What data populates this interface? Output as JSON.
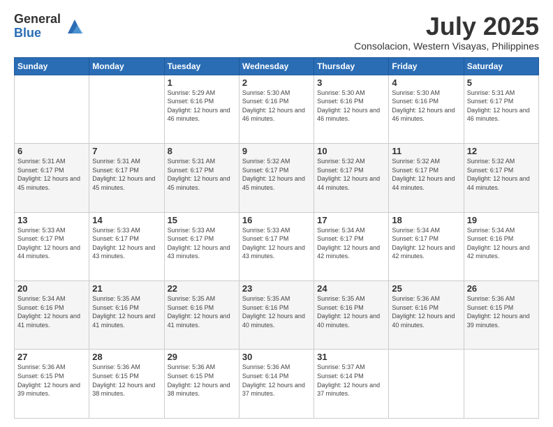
{
  "logo": {
    "general": "General",
    "blue": "Blue"
  },
  "header": {
    "month": "July 2025",
    "location": "Consolacion, Western Visayas, Philippines"
  },
  "weekdays": [
    "Sunday",
    "Monday",
    "Tuesday",
    "Wednesday",
    "Thursday",
    "Friday",
    "Saturday"
  ],
  "weeks": [
    [
      {
        "day": "",
        "info": ""
      },
      {
        "day": "",
        "info": ""
      },
      {
        "day": "1",
        "info": "Sunrise: 5:29 AM\nSunset: 6:16 PM\nDaylight: 12 hours and 46 minutes."
      },
      {
        "day": "2",
        "info": "Sunrise: 5:30 AM\nSunset: 6:16 PM\nDaylight: 12 hours and 46 minutes."
      },
      {
        "day": "3",
        "info": "Sunrise: 5:30 AM\nSunset: 6:16 PM\nDaylight: 12 hours and 46 minutes."
      },
      {
        "day": "4",
        "info": "Sunrise: 5:30 AM\nSunset: 6:16 PM\nDaylight: 12 hours and 46 minutes."
      },
      {
        "day": "5",
        "info": "Sunrise: 5:31 AM\nSunset: 6:17 PM\nDaylight: 12 hours and 46 minutes."
      }
    ],
    [
      {
        "day": "6",
        "info": "Sunrise: 5:31 AM\nSunset: 6:17 PM\nDaylight: 12 hours and 45 minutes."
      },
      {
        "day": "7",
        "info": "Sunrise: 5:31 AM\nSunset: 6:17 PM\nDaylight: 12 hours and 45 minutes."
      },
      {
        "day": "8",
        "info": "Sunrise: 5:31 AM\nSunset: 6:17 PM\nDaylight: 12 hours and 45 minutes."
      },
      {
        "day": "9",
        "info": "Sunrise: 5:32 AM\nSunset: 6:17 PM\nDaylight: 12 hours and 45 minutes."
      },
      {
        "day": "10",
        "info": "Sunrise: 5:32 AM\nSunset: 6:17 PM\nDaylight: 12 hours and 44 minutes."
      },
      {
        "day": "11",
        "info": "Sunrise: 5:32 AM\nSunset: 6:17 PM\nDaylight: 12 hours and 44 minutes."
      },
      {
        "day": "12",
        "info": "Sunrise: 5:32 AM\nSunset: 6:17 PM\nDaylight: 12 hours and 44 minutes."
      }
    ],
    [
      {
        "day": "13",
        "info": "Sunrise: 5:33 AM\nSunset: 6:17 PM\nDaylight: 12 hours and 44 minutes."
      },
      {
        "day": "14",
        "info": "Sunrise: 5:33 AM\nSunset: 6:17 PM\nDaylight: 12 hours and 43 minutes."
      },
      {
        "day": "15",
        "info": "Sunrise: 5:33 AM\nSunset: 6:17 PM\nDaylight: 12 hours and 43 minutes."
      },
      {
        "day": "16",
        "info": "Sunrise: 5:33 AM\nSunset: 6:17 PM\nDaylight: 12 hours and 43 minutes."
      },
      {
        "day": "17",
        "info": "Sunrise: 5:34 AM\nSunset: 6:17 PM\nDaylight: 12 hours and 42 minutes."
      },
      {
        "day": "18",
        "info": "Sunrise: 5:34 AM\nSunset: 6:17 PM\nDaylight: 12 hours and 42 minutes."
      },
      {
        "day": "19",
        "info": "Sunrise: 5:34 AM\nSunset: 6:16 PM\nDaylight: 12 hours and 42 minutes."
      }
    ],
    [
      {
        "day": "20",
        "info": "Sunrise: 5:34 AM\nSunset: 6:16 PM\nDaylight: 12 hours and 41 minutes."
      },
      {
        "day": "21",
        "info": "Sunrise: 5:35 AM\nSunset: 6:16 PM\nDaylight: 12 hours and 41 minutes."
      },
      {
        "day": "22",
        "info": "Sunrise: 5:35 AM\nSunset: 6:16 PM\nDaylight: 12 hours and 41 minutes."
      },
      {
        "day": "23",
        "info": "Sunrise: 5:35 AM\nSunset: 6:16 PM\nDaylight: 12 hours and 40 minutes."
      },
      {
        "day": "24",
        "info": "Sunrise: 5:35 AM\nSunset: 6:16 PM\nDaylight: 12 hours and 40 minutes."
      },
      {
        "day": "25",
        "info": "Sunrise: 5:36 AM\nSunset: 6:16 PM\nDaylight: 12 hours and 40 minutes."
      },
      {
        "day": "26",
        "info": "Sunrise: 5:36 AM\nSunset: 6:15 PM\nDaylight: 12 hours and 39 minutes."
      }
    ],
    [
      {
        "day": "27",
        "info": "Sunrise: 5:36 AM\nSunset: 6:15 PM\nDaylight: 12 hours and 39 minutes."
      },
      {
        "day": "28",
        "info": "Sunrise: 5:36 AM\nSunset: 6:15 PM\nDaylight: 12 hours and 38 minutes."
      },
      {
        "day": "29",
        "info": "Sunrise: 5:36 AM\nSunset: 6:15 PM\nDaylight: 12 hours and 38 minutes."
      },
      {
        "day": "30",
        "info": "Sunrise: 5:36 AM\nSunset: 6:14 PM\nDaylight: 12 hours and 37 minutes."
      },
      {
        "day": "31",
        "info": "Sunrise: 5:37 AM\nSunset: 6:14 PM\nDaylight: 12 hours and 37 minutes."
      },
      {
        "day": "",
        "info": ""
      },
      {
        "day": "",
        "info": ""
      }
    ]
  ]
}
